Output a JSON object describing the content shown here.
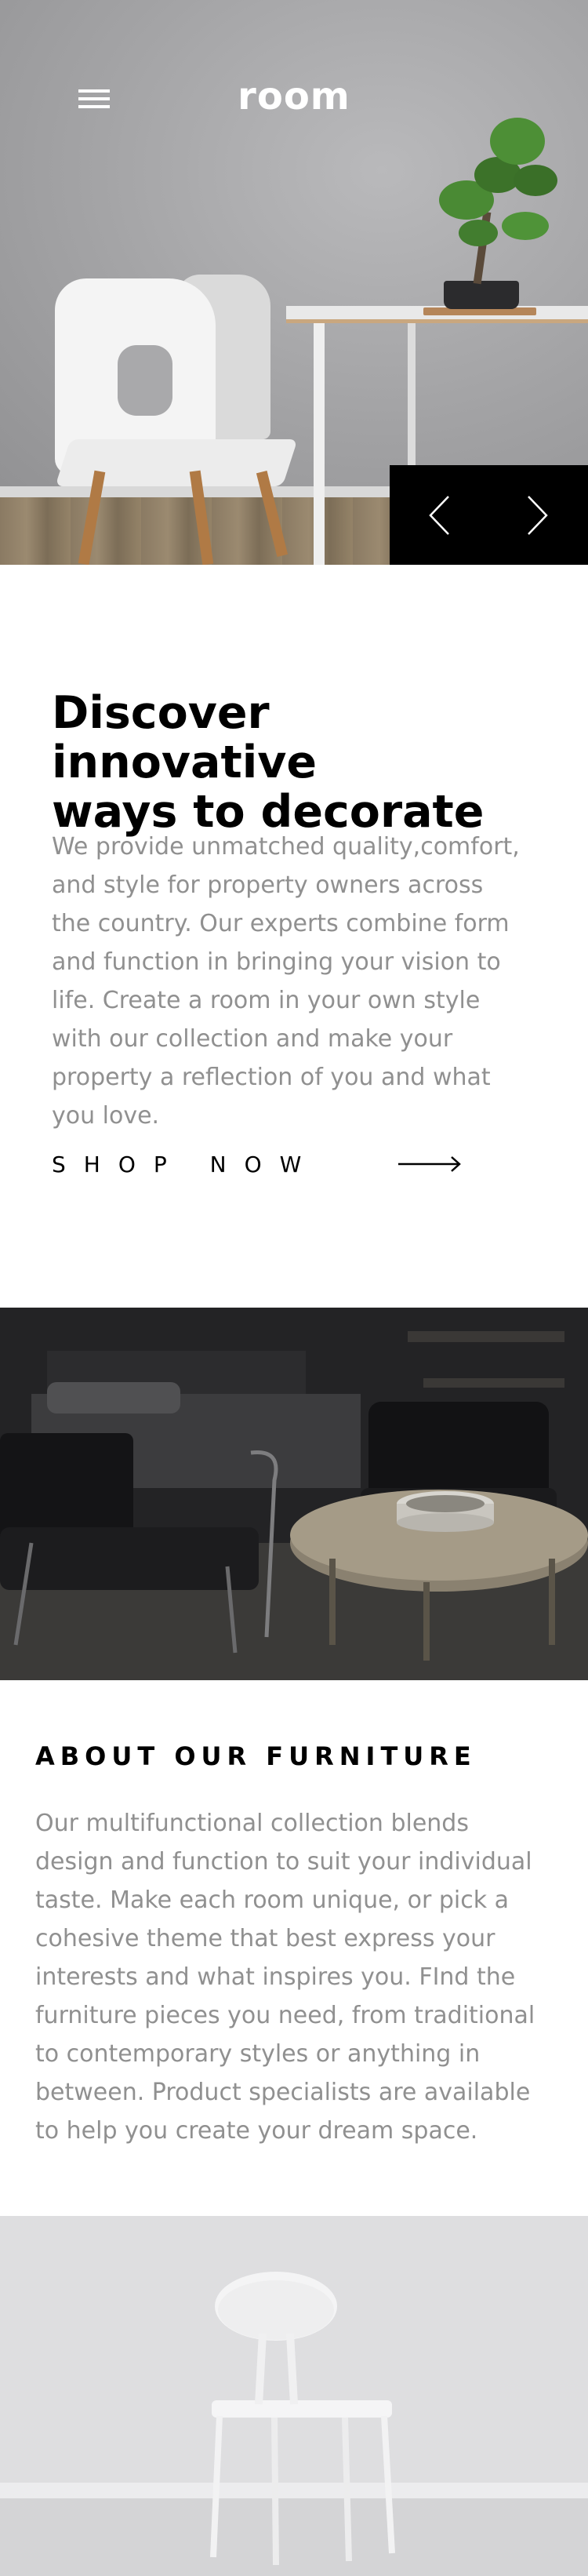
{
  "header": {
    "logo": "room",
    "menu_icon": "hamburger-menu-icon"
  },
  "hero": {
    "image": "white chair beside table with bonsai plant",
    "prev_icon": "chevron-left-icon",
    "next_icon": "chevron-right-icon"
  },
  "discover": {
    "title": "Discover innovative\nways to decorate",
    "text": "We provide unmatched quality,comfort, and style for property owners across the country. Our experts combine form and function in bringing your vision to life. Create a room in your own style with our collection and make your property a reflection of you and what you love.",
    "cta_label": "SHOP NOW",
    "cta_icon": "arrow-right-icon"
  },
  "interior_image": "dark living room with armchair and round coffee table",
  "about": {
    "title": "ABOUT OUR FURNITURE",
    "text": "Our multifunctional collection blends design and function to suit your individual taste. Make each room unique, or pick a cohesive theme that best express your interests and what inspires you. FInd the furniture pieces you need, from traditional to contemporary styles or anything in between. Product specialists are available to help you create your dream space."
  },
  "bottom_image": "white chair against light grey wall",
  "colors": {
    "text_primary": "#000000",
    "text_muted": "#909090",
    "slider_bg": "#000000",
    "page_bg": "#ffffff"
  }
}
